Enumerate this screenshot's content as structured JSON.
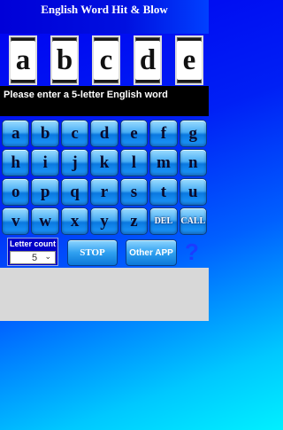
{
  "title": "English Word Hit & Blow",
  "tiles": [
    "a",
    "b",
    "c",
    "d",
    "e"
  ],
  "message": "Please enter a 5-letter English word",
  "keys": [
    "a",
    "b",
    "c",
    "d",
    "e",
    "f",
    "g",
    "h",
    "i",
    "j",
    "k",
    "l",
    "m",
    "n",
    "o",
    "p",
    "q",
    "r",
    "s",
    "t",
    "u",
    "v",
    "w",
    "x",
    "y",
    "z",
    "DEL",
    "CALL"
  ],
  "controls": {
    "letter_count_label": "Letter count",
    "letter_count_value": "5",
    "stop_label": "STOP",
    "other_app_label": "Other APP",
    "help_label": "?"
  }
}
